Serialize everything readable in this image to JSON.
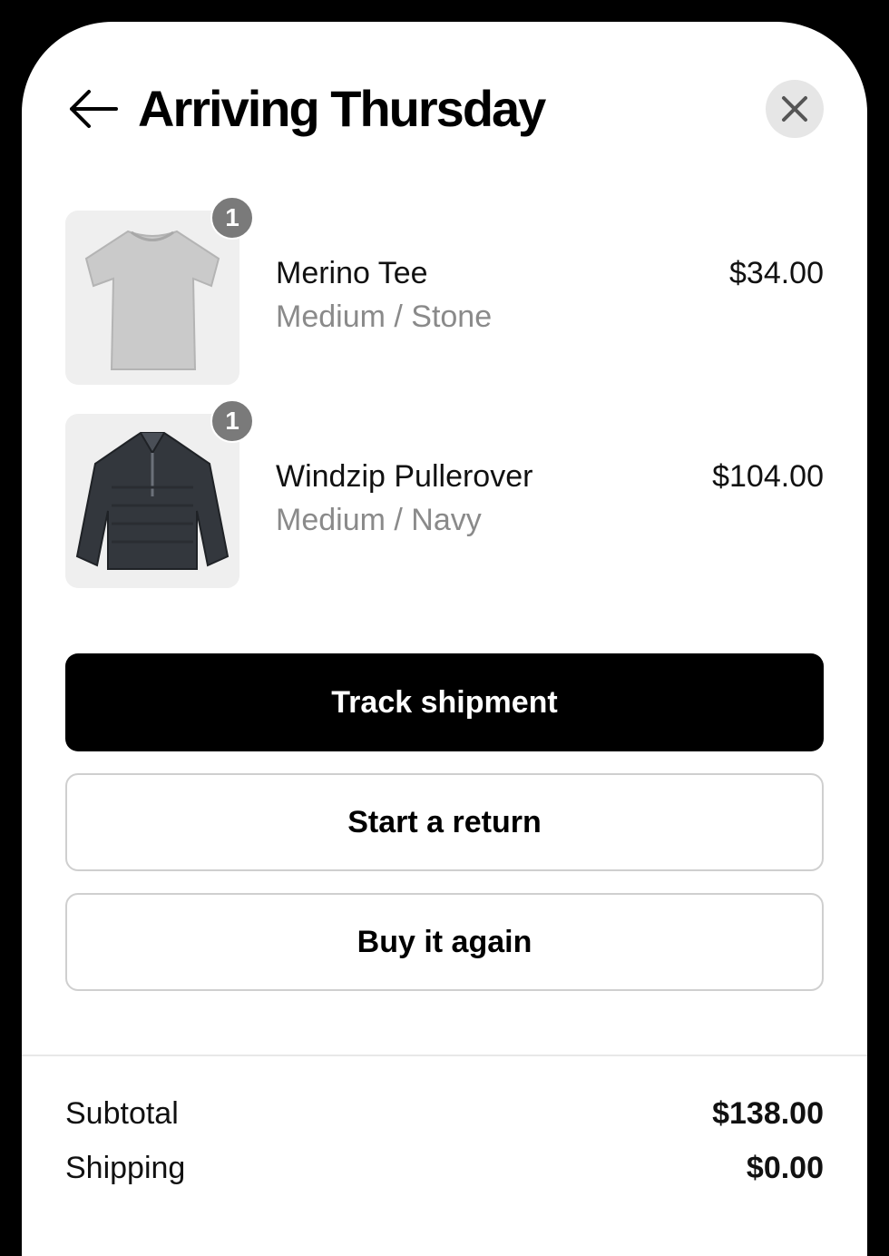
{
  "header": {
    "title": "Arriving Thursday",
    "back_icon": "arrow-left-icon",
    "close_icon": "close-icon"
  },
  "items": [
    {
      "name": "Merino Tee",
      "variant": "Medium / Stone",
      "price": "$34.00",
      "quantity": "1",
      "image": "tshirt-image"
    },
    {
      "name": "Windzip Pullerover",
      "variant": "Medium / Navy",
      "price": "$104.00",
      "quantity": "1",
      "image": "pullover-image"
    }
  ],
  "actions": {
    "track": "Track shipment",
    "return": "Start a return",
    "buy_again": "Buy it again"
  },
  "summary": {
    "subtotal_label": "Subtotal",
    "subtotal_value": "$138.00",
    "shipping_label": "Shipping",
    "shipping_value": "$0.00"
  },
  "colors": {
    "primary": "#000000",
    "muted_text": "#8a8a8a",
    "badge": "#7a7a7a",
    "border": "#cfcfcf"
  }
}
